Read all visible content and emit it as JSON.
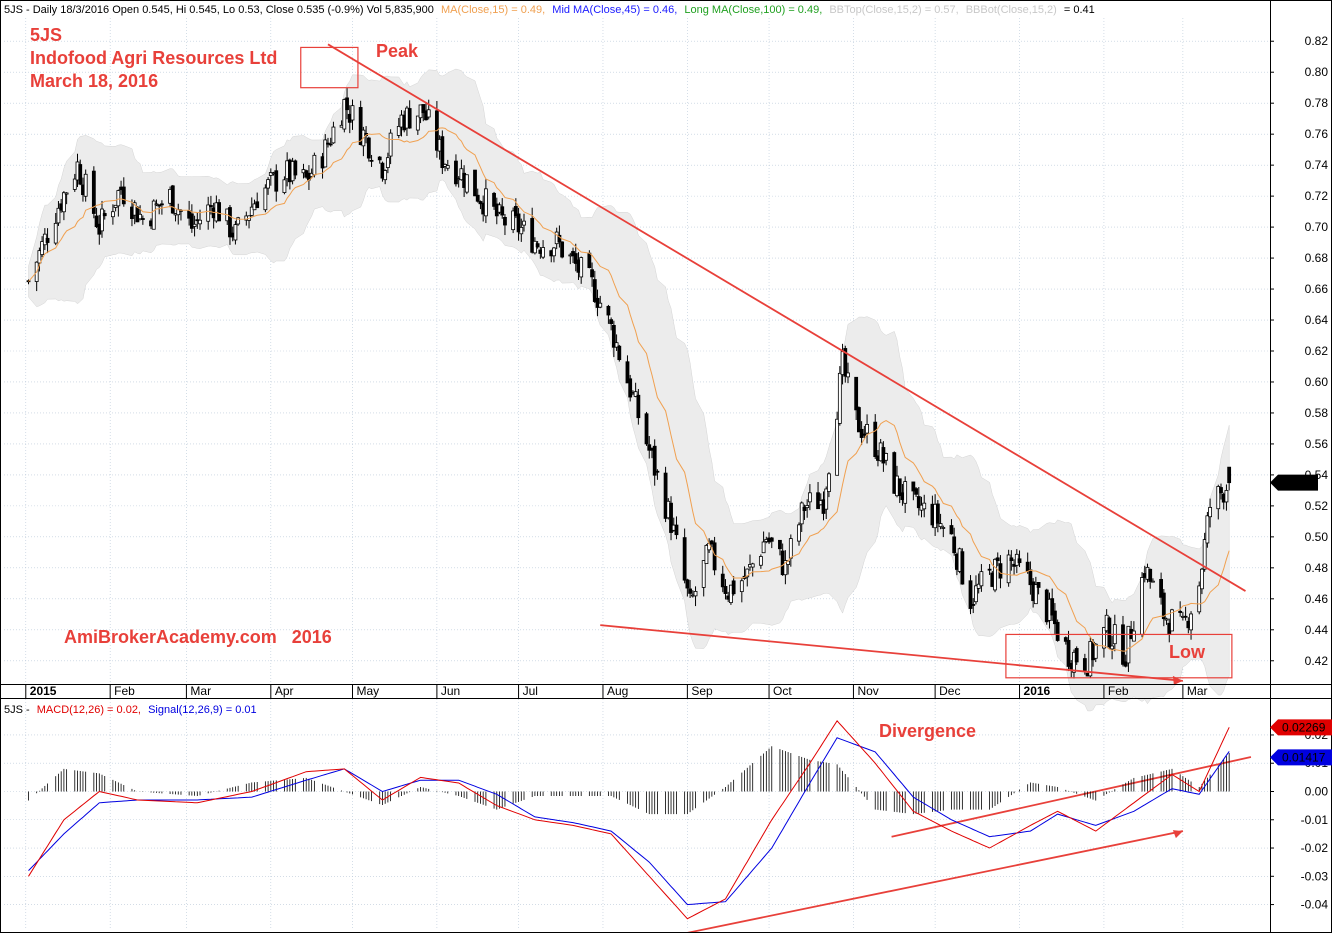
{
  "header": {
    "price_line": {
      "prefix": "5JS - Daily 18/3/2016 Open 0.545, Hi 0.545, Lo 0.53, Close 0.535 (-0.9%) Vol 5,835,900",
      "ma15": "MA(Close,15) = 0.49,",
      "ma45": "Mid MA(Close,45) = 0.46,",
      "ma100": "Long MA(Close,100) = 0.49,",
      "bbtop": "BBTop(Close,15,2) = 0.57,",
      "bbbot_label": "BBBot(Close,15,2)",
      "bbbot_value": "= 0.41"
    },
    "macd_line": {
      "prefix": "5JS -",
      "macd": "MACD(12,26) = 0.02,",
      "signal": "Signal(12,26,9) = 0.01"
    }
  },
  "annotations": {
    "ticker": "5JS",
    "company": "Indofood Agri Resources Ltd",
    "date": "March 18, 2016",
    "peak": "Peak",
    "low": "Low",
    "divergence": "Divergence",
    "watermark": "AmiBrokerAcademy.com   2016"
  },
  "colors": {
    "annotation_red": "#e8403a",
    "ma15": "#f0a050",
    "mid_ma": "#1a1aff",
    "long_ma": "#20a020",
    "bbands_fill": "#ececec",
    "macd": "#e00000",
    "signal": "#0000e0",
    "histogram": "#000000",
    "grid": "#b9c8d8"
  },
  "chart_data": [
    {
      "type": "candlestick",
      "title": "5JS - Daily",
      "series_name": "5JS",
      "x_label_months": [
        "2015",
        "Feb",
        "Mar",
        "Apr",
        "May",
        "Jun",
        "Jul",
        "Aug",
        "Sep",
        "Oct",
        "Nov",
        "Dec",
        "2016",
        "Feb",
        "Mar"
      ],
      "y_ticks": [
        "0.82",
        "0.80",
        "0.78",
        "0.76",
        "0.74",
        "0.72",
        "0.70",
        "0.68",
        "0.66",
        "0.64",
        "0.62",
        "0.60",
        "0.58",
        "0.56",
        "0.54",
        "0.52",
        "0.50",
        "0.48",
        "0.46",
        "0.44",
        "0.42"
      ],
      "ylim": [
        0.405,
        0.835
      ],
      "last_close": "0.535",
      "grid": true,
      "trend_path": [
        [
          "2015-01-02",
          0.665
        ],
        [
          "2015-01-12",
          0.71
        ],
        [
          "2015-01-20",
          0.74
        ],
        [
          "2015-01-28",
          0.7
        ],
        [
          "2015-02-05",
          0.725
        ],
        [
          "2015-02-13",
          0.705
        ],
        [
          "2015-02-23",
          0.72
        ],
        [
          "2015-03-03",
          0.7
        ],
        [
          "2015-03-11",
          0.715
        ],
        [
          "2015-03-19",
          0.695
        ],
        [
          "2015-03-27",
          0.72
        ],
        [
          "2015-04-06",
          0.735
        ],
        [
          "2015-04-14",
          0.73
        ],
        [
          "2015-04-21",
          0.75
        ],
        [
          "2015-04-28",
          0.78
        ],
        [
          "2015-05-05",
          0.76
        ],
        [
          "2015-05-12",
          0.74
        ],
        [
          "2015-05-19",
          0.77
        ],
        [
          "2015-05-27",
          0.775
        ],
        [
          "2015-06-03",
          0.745
        ],
        [
          "2015-06-10",
          0.735
        ],
        [
          "2015-06-17",
          0.72
        ],
        [
          "2015-06-24",
          0.705
        ],
        [
          "2015-07-01",
          0.7
        ],
        [
          "2015-07-08",
          0.69
        ],
        [
          "2015-07-15",
          0.69
        ],
        [
          "2015-07-22",
          0.675
        ],
        [
          "2015-07-29",
          0.66
        ],
        [
          "2015-08-05",
          0.63
        ],
        [
          "2015-08-12",
          0.59
        ],
        [
          "2015-08-19",
          0.55
        ],
        [
          "2015-08-26",
          0.51
        ],
        [
          "2015-09-02",
          0.455
        ],
        [
          "2015-09-09",
          0.49
        ],
        [
          "2015-09-16",
          0.465
        ],
        [
          "2015-09-23",
          0.475
        ],
        [
          "2015-09-30",
          0.5
        ],
        [
          "2015-10-07",
          0.48
        ],
        [
          "2015-10-14",
          0.52
        ],
        [
          "2015-10-21",
          0.525
        ],
        [
          "2015-10-28",
          0.61
        ],
        [
          "2015-11-02",
          0.575
        ],
        [
          "2015-11-09",
          0.56
        ],
        [
          "2015-11-16",
          0.535
        ],
        [
          "2015-11-23",
          0.52
        ],
        [
          "2015-11-30",
          0.515
        ],
        [
          "2015-12-07",
          0.5
        ],
        [
          "2015-12-14",
          0.46
        ],
        [
          "2015-12-21",
          0.475
        ],
        [
          "2015-12-28",
          0.485
        ],
        [
          "2016-01-05",
          0.47
        ],
        [
          "2016-01-12",
          0.45
        ],
        [
          "2016-01-19",
          0.425
        ],
        [
          "2016-01-26",
          0.42
        ],
        [
          "2016-02-02",
          0.44
        ],
        [
          "2016-02-09",
          0.425
        ],
        [
          "2016-02-16",
          0.48
        ],
        [
          "2016-02-23",
          0.45
        ],
        [
          "2016-03-01",
          0.44
        ],
        [
          "2016-03-07",
          0.47
        ],
        [
          "2016-03-11",
          0.52
        ],
        [
          "2016-03-18",
          0.535
        ]
      ],
      "trendlines": [
        {
          "name": "resistance",
          "from": [
            "2015-04-22",
            0.818
          ],
          "to": [
            "2016-03-24",
            0.465
          ]
        },
        {
          "name": "lower-lows",
          "from": [
            "2015-07-31",
            0.443
          ],
          "to": [
            "2016-03-01",
            0.407
          ]
        }
      ],
      "boxes": [
        {
          "name": "peak-box",
          "from": [
            "2015-04-12",
            0.79
          ],
          "to": [
            "2015-05-03",
            0.816
          ]
        },
        {
          "name": "low-box",
          "from": [
            "2015-12-27",
            0.409
          ],
          "to": [
            "2016-03-19",
            0.437
          ]
        }
      ]
    },
    {
      "type": "line",
      "title": "5JS - MACD",
      "series": [
        {
          "name": "MACD(12,26)",
          "color": "#e00000",
          "points": [
            [
              "2015-01-02",
              -0.03
            ],
            [
              "2015-01-15",
              -0.01
            ],
            [
              "2015-01-28",
              0.0
            ],
            [
              "2015-02-11",
              -0.003
            ],
            [
              "2015-03-05",
              -0.004
            ],
            [
              "2015-03-25",
              0.0
            ],
            [
              "2015-04-14",
              0.007
            ],
            [
              "2015-04-28",
              0.008
            ],
            [
              "2015-05-12",
              -0.003
            ],
            [
              "2015-05-26",
              0.005
            ],
            [
              "2015-06-09",
              0.003
            ],
            [
              "2015-06-23",
              -0.005
            ],
            [
              "2015-07-07",
              -0.01
            ],
            [
              "2015-07-21",
              -0.012
            ],
            [
              "2015-08-04",
              -0.015
            ],
            [
              "2015-08-18",
              -0.03
            ],
            [
              "2015-09-01",
              -0.045
            ],
            [
              "2015-09-15",
              -0.038
            ],
            [
              "2015-10-02",
              -0.01
            ],
            [
              "2015-10-16",
              0.01
            ],
            [
              "2015-10-26",
              0.025
            ],
            [
              "2015-11-09",
              0.01
            ],
            [
              "2015-11-23",
              -0.007
            ],
            [
              "2015-12-07",
              -0.014
            ],
            [
              "2015-12-21",
              -0.02
            ],
            [
              "2016-01-05",
              -0.012
            ],
            [
              "2016-01-15",
              -0.007
            ],
            [
              "2016-01-29",
              -0.014
            ],
            [
              "2016-02-12",
              -0.004
            ],
            [
              "2016-02-26",
              0.006
            ],
            [
              "2016-03-07",
              0.0
            ],
            [
              "2016-03-18",
              0.0227
            ]
          ]
        },
        {
          "name": "Signal(12,26,9)",
          "color": "#0000e0",
          "points": [
            [
              "2015-01-02",
              -0.028
            ],
            [
              "2015-01-15",
              -0.015
            ],
            [
              "2015-01-28",
              -0.004
            ],
            [
              "2015-02-11",
              -0.003
            ],
            [
              "2015-03-05",
              -0.003
            ],
            [
              "2015-03-25",
              -0.002
            ],
            [
              "2015-04-14",
              0.004
            ],
            [
              "2015-04-28",
              0.008
            ],
            [
              "2015-05-12",
              0.0
            ],
            [
              "2015-05-26",
              0.004
            ],
            [
              "2015-06-09",
              0.004
            ],
            [
              "2015-06-23",
              -0.001
            ],
            [
              "2015-07-07",
              -0.009
            ],
            [
              "2015-07-21",
              -0.011
            ],
            [
              "2015-08-04",
              -0.014
            ],
            [
              "2015-08-18",
              -0.025
            ],
            [
              "2015-09-01",
              -0.04
            ],
            [
              "2015-09-15",
              -0.039
            ],
            [
              "2015-10-02",
              -0.02
            ],
            [
              "2015-10-16",
              0.003
            ],
            [
              "2015-10-26",
              0.019
            ],
            [
              "2015-11-09",
              0.014
            ],
            [
              "2015-11-23",
              -0.002
            ],
            [
              "2015-12-07",
              -0.01
            ],
            [
              "2015-12-21",
              -0.016
            ],
            [
              "2016-01-05",
              -0.014
            ],
            [
              "2016-01-15",
              -0.008
            ],
            [
              "2016-01-29",
              -0.012
            ],
            [
              "2016-02-12",
              -0.007
            ],
            [
              "2016-02-26",
              0.001
            ],
            [
              "2016-03-07",
              -0.001
            ],
            [
              "2016-03-18",
              0.0142
            ]
          ]
        }
      ],
      "y_ticks": [
        "0.02",
        "0.01",
        "0.00",
        "-0.01",
        "-0.02",
        "-0.03",
        "-0.04"
      ],
      "ylim": [
        -0.049,
        0.026
      ],
      "last_values": {
        "macd": "0.02269",
        "signal": "0.01417"
      },
      "trendlines": [
        {
          "name": "upper-divergence",
          "from": [
            "2015-11-15",
            -0.016
          ],
          "to": [
            "2016-03-26",
            0.0122
          ]
        },
        {
          "name": "lower-divergence",
          "from": [
            "2015-09-01",
            -0.05
          ],
          "to": [
            "2016-03-01",
            -0.014
          ]
        }
      ]
    }
  ]
}
